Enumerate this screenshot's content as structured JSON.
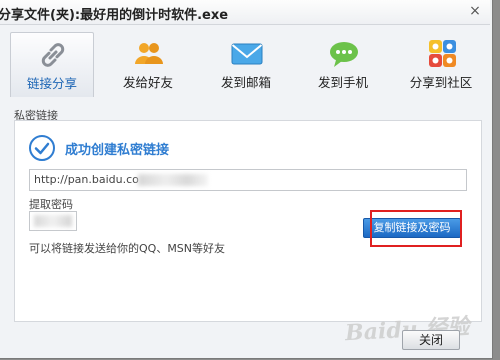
{
  "window": {
    "title": "分享文件(夹):最好用的倒计时软件.exe",
    "close_glyph": "×"
  },
  "tabs": [
    {
      "label": "链接分享",
      "icon": "chain-link-icon",
      "active": true
    },
    {
      "label": "发给好友",
      "icon": "friends-icon",
      "active": false
    },
    {
      "label": "发到邮箱",
      "icon": "envelope-icon",
      "active": false
    },
    {
      "label": "发到手机",
      "icon": "chat-bubble-icon",
      "active": false
    },
    {
      "label": "分享到社区",
      "icon": "social-grid-icon",
      "active": false
    }
  ],
  "section_label": "私密链接",
  "panel": {
    "success_text": "成功创建私密链接",
    "link_value": "http://pan.baidu.co",
    "code_label": "提取密码",
    "copy_button": "复制链接及密码",
    "hint": "可以将链接发送给你的QQ、MSN等好友"
  },
  "footer": {
    "close_button": "关闭"
  },
  "watermark": "Baidu 经验",
  "colors": {
    "accent": "#2f7dd1",
    "highlight_frame": "#e02020"
  }
}
